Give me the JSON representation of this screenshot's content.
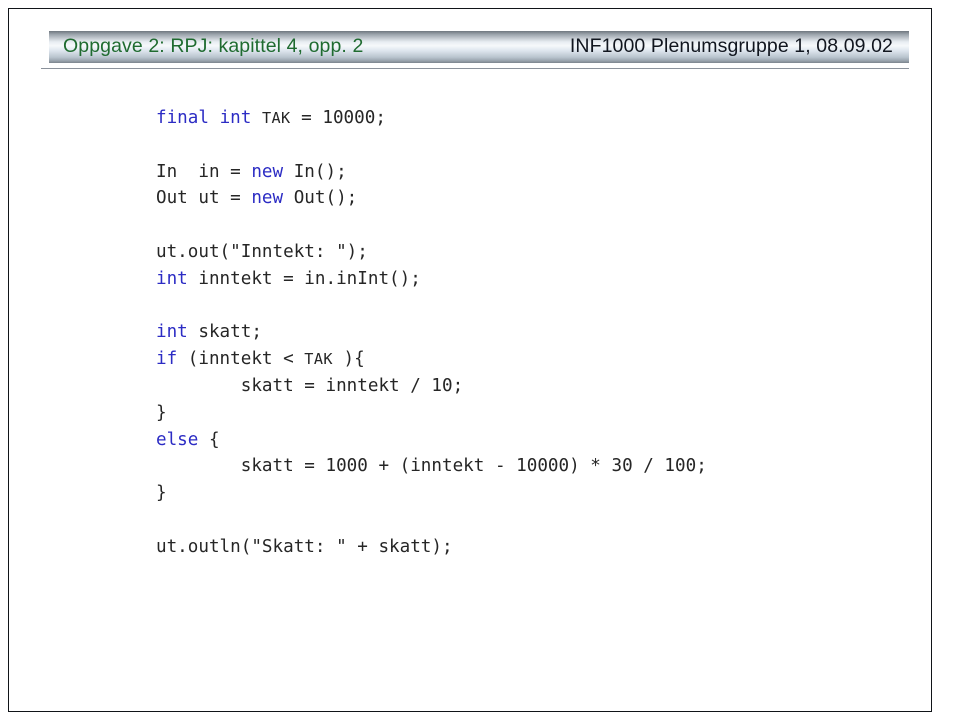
{
  "slide": {
    "header": {
      "title": "Oppgave 2: RPJ: kapittel 4, opp. 2",
      "meta": "INF1000  Plenumsgruppe 1, 08.09.02",
      "title_color": "#1f6b30",
      "meta_color": "#11161f",
      "rule_color": "#8b929b"
    },
    "code": {
      "keyword_color": "#2c2cc4",
      "text_color": "#262626",
      "lines": [
        {
          "id": "line-final-tak",
          "segments": [
            {
              "t": "final",
              "k": true
            },
            {
              "t": " ",
              "k": false
            },
            {
              "t": "int",
              "k": true
            },
            {
              "t": " ",
              "k": false
            },
            {
              "t": "TAK",
              "k": false,
              "small": true
            },
            {
              "t": " = 10000;",
              "k": false
            }
          ]
        },
        {
          "id": "line-blank-1",
          "segments": []
        },
        {
          "id": "line-in-declare",
          "segments": [
            {
              "t": "In  in = ",
              "k": false
            },
            {
              "t": "new",
              "k": true
            },
            {
              "t": " In();",
              "k": false
            }
          ]
        },
        {
          "id": "line-out-declare",
          "segments": [
            {
              "t": "Out ut = ",
              "k": false
            },
            {
              "t": "new",
              "k": true
            },
            {
              "t": " Out();",
              "k": false
            }
          ]
        },
        {
          "id": "line-blank-2",
          "segments": []
        },
        {
          "id": "line-ut-out-inntekt",
          "segments": [
            {
              "t": "ut.out(\"Inntekt: \");",
              "k": false
            }
          ]
        },
        {
          "id": "line-int-inntekt",
          "segments": [
            {
              "t": "int",
              "k": true
            },
            {
              "t": " inntekt = in.inInt();",
              "k": false
            }
          ]
        },
        {
          "id": "line-blank-3",
          "segments": []
        },
        {
          "id": "line-int-skatt",
          "segments": [
            {
              "t": "int",
              "k": true
            },
            {
              "t": " skatt;",
              "k": false
            }
          ]
        },
        {
          "id": "line-if",
          "segments": [
            {
              "t": "if",
              "k": true
            },
            {
              "t": " (inntekt < ",
              "k": false
            },
            {
              "t": "TAK",
              "k": false,
              "small": true
            },
            {
              "t": " ){",
              "k": false
            }
          ]
        },
        {
          "id": "line-if-body",
          "segments": [
            {
              "t": "        skatt = inntekt / 10;",
              "k": false
            }
          ]
        },
        {
          "id": "line-if-close",
          "segments": [
            {
              "t": "}",
              "k": false
            }
          ]
        },
        {
          "id": "line-else",
          "segments": [
            {
              "t": "else",
              "k": true
            },
            {
              "t": " {",
              "k": false
            }
          ]
        },
        {
          "id": "line-else-body",
          "segments": [
            {
              "t": "        skatt = 1000 + (inntekt - 10000) * 30 / 100;",
              "k": false
            }
          ]
        },
        {
          "id": "line-else-close",
          "segments": [
            {
              "t": "}",
              "k": false
            }
          ]
        },
        {
          "id": "line-blank-4",
          "segments": []
        },
        {
          "id": "line-ut-outln",
          "segments": [
            {
              "t": "ut.outln(\"Skatt: \" + skatt);",
              "k": false
            }
          ]
        }
      ]
    }
  }
}
